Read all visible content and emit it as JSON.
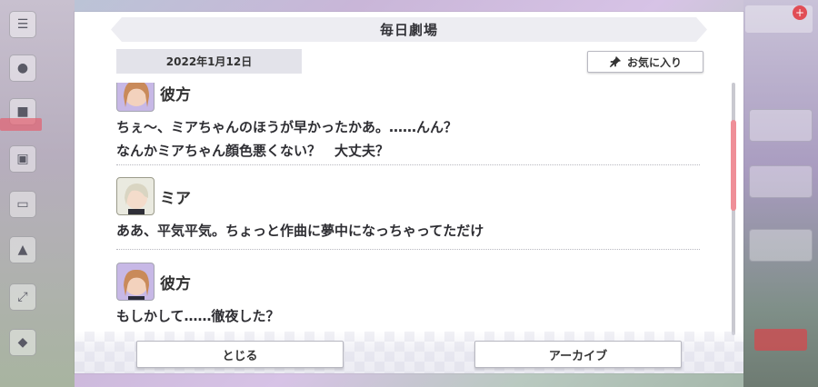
{
  "dialog": {
    "title": "毎日劇場",
    "date": "2022年1月12日",
    "favorite_label": "お気に入り",
    "close_label": "とじる",
    "archive_label": "アーカイブ"
  },
  "entries": [
    {
      "speaker": "彼方",
      "lines": [
        "ちぇ〜、ミアちゃんのほうが早かったかあ。……んん？",
        "なんかミアちゃん顔色悪くない？　大丈夫？"
      ]
    },
    {
      "speaker": "ミア",
      "lines": [
        "ああ、平気平気。ちょっと作曲に夢中になっちゃってただけ"
      ]
    },
    {
      "speaker": "彼方",
      "lines": [
        "もしかして……徹夜した？"
      ]
    }
  ],
  "colors": {
    "scroll_thumb": "#ef8f98",
    "accent_red": "#e14d56"
  },
  "icons": {
    "favorite": "pin-icon",
    "menu": "hamburger-icon"
  }
}
